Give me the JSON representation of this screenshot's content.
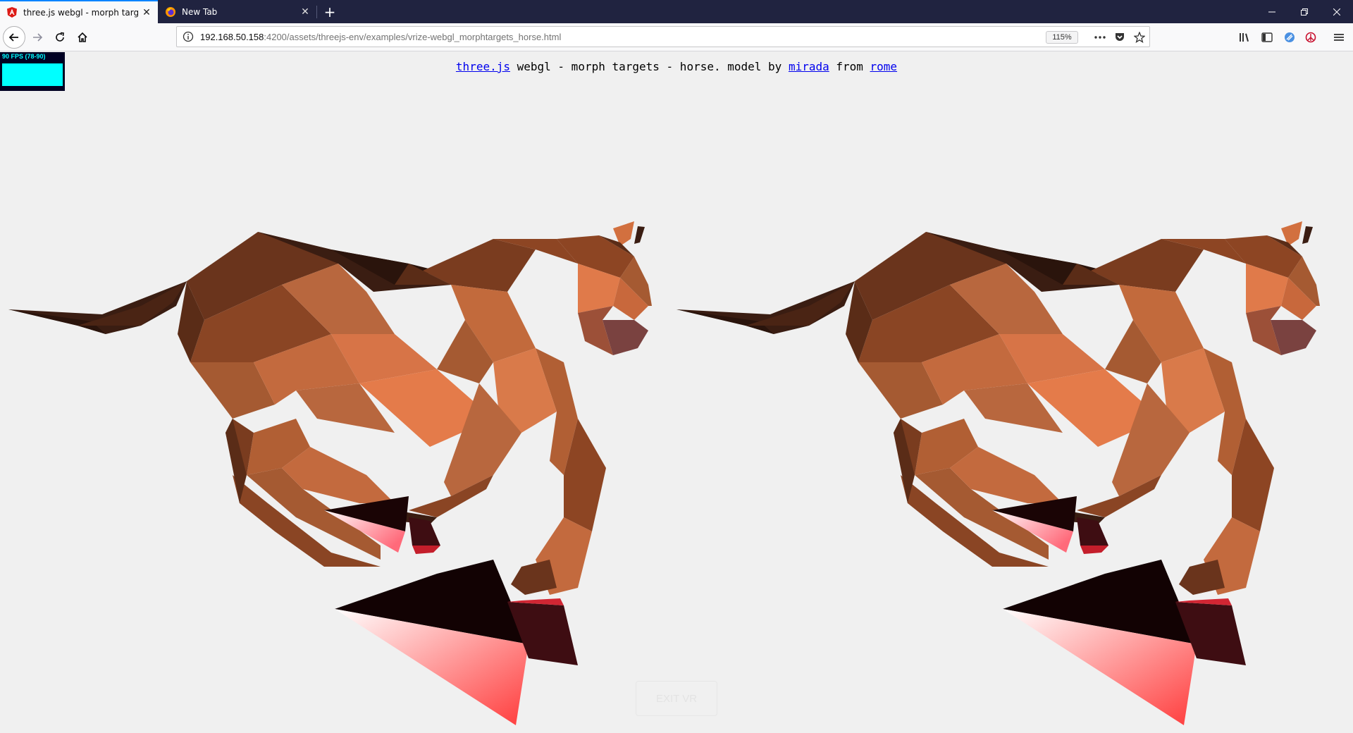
{
  "browser": {
    "tabs": [
      {
        "title": "three.js webgl - morph targets",
        "favicon": "angular-icon"
      },
      {
        "title": "New Tab",
        "favicon": "firefox-icon"
      }
    ],
    "new_tab_label": "+",
    "url_host": "192.168.50.158",
    "url_rest": ":4200/assets/threejs-env/examples/vrize-webgl_morphtargets_horse.html",
    "zoom": "115%"
  },
  "page": {
    "info": {
      "link1": "three.js",
      "text1": " webgl - morph targets - horse. model by ",
      "link2": "mirada",
      "text2": " from ",
      "link3": "rome"
    },
    "fps": "90 FPS (78-90)",
    "exit_vr": "EXIT VR"
  },
  "colors": {
    "tab_bar": "#202340",
    "accent": "#0a84ff",
    "fps_graph": "#00ffff",
    "horse_mid": "#b8673e",
    "horse_light": "#e47b4a",
    "horse_dark": "#3a1d12",
    "controller_pink": "#ff4a4a"
  }
}
